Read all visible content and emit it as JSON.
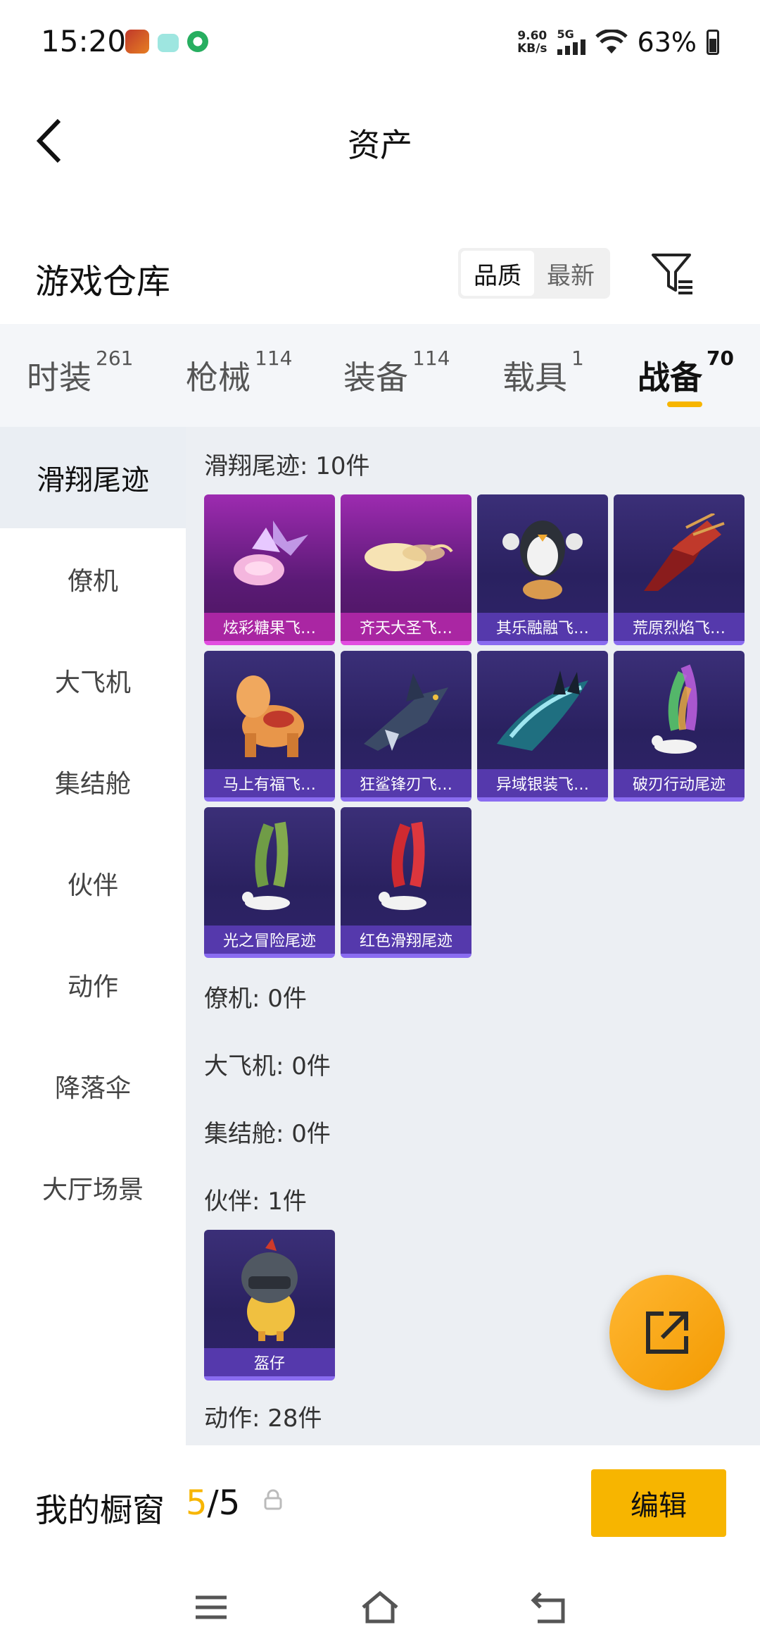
{
  "status_bar": {
    "time": "15:20",
    "net_speed_value": "9.60",
    "net_speed_unit": "KB/s",
    "network_type": "5G",
    "battery": "63%"
  },
  "header": {
    "title": "资产"
  },
  "warehouse": {
    "title": "游戏仓库",
    "sort_options": [
      "品质",
      "最新"
    ],
    "active_sort": "品质"
  },
  "tabs": [
    {
      "label": "时装",
      "count": "261"
    },
    {
      "label": "枪械",
      "count": "114"
    },
    {
      "label": "装备",
      "count": "114"
    },
    {
      "label": "载具",
      "count": "1"
    },
    {
      "label": "战备",
      "count": "70"
    }
  ],
  "active_tab": "战备",
  "sidebar": {
    "items": [
      "滑翔尾迹",
      "僚机",
      "大飞机",
      "集结舱",
      "伙伴",
      "动作",
      "降落伞",
      "大厅场景"
    ],
    "active": "滑翔尾迹"
  },
  "sections": {
    "glide_trail": "滑翔尾迹: 10件",
    "wingman": "僚机: 0件",
    "big_plane": "大飞机: 0件",
    "assembly_pod": "集结舱: 0件",
    "partner": "伙伴: 1件",
    "action": "动作: 28件"
  },
  "glide_items": [
    {
      "name": "炫彩糖果飞…",
      "rarity": "pink",
      "icon": "candy-glider-icon"
    },
    {
      "name": "齐天大圣飞…",
      "rarity": "pink",
      "icon": "cloud-glider-icon"
    },
    {
      "name": "其乐融融飞…",
      "rarity": "purple",
      "icon": "penguin-glider-icon"
    },
    {
      "name": "荒原烈焰飞…",
      "rarity": "purple",
      "icon": "flame-glider-icon"
    },
    {
      "name": "马上有福飞…",
      "rarity": "purple",
      "icon": "horse-glider-icon"
    },
    {
      "name": "狂鲨锋刃飞…",
      "rarity": "purple",
      "icon": "shark-glider-icon"
    },
    {
      "name": "异域银装飞…",
      "rarity": "purple",
      "icon": "silver-glider-icon"
    },
    {
      "name": "破刃行动尾迹",
      "rarity": "purple",
      "icon": "rainbow-smoke-trail-icon"
    },
    {
      "name": "光之冒险尾迹",
      "rarity": "purple",
      "icon": "green-smoke-trail-icon"
    },
    {
      "name": "红色滑翔尾迹",
      "rarity": "purple",
      "icon": "red-smoke-trail-icon"
    }
  ],
  "partner_items": [
    {
      "name": "盔仔",
      "rarity": "purple",
      "icon": "helmet-chick-icon"
    }
  ],
  "showcase": {
    "title": "我的橱窗",
    "current": "5",
    "total": "/5",
    "edit_label": "编辑"
  },
  "colors": {
    "accent": "#f7b500",
    "card_purple": "#2a2160",
    "card_pink": "#9d2bb0"
  }
}
